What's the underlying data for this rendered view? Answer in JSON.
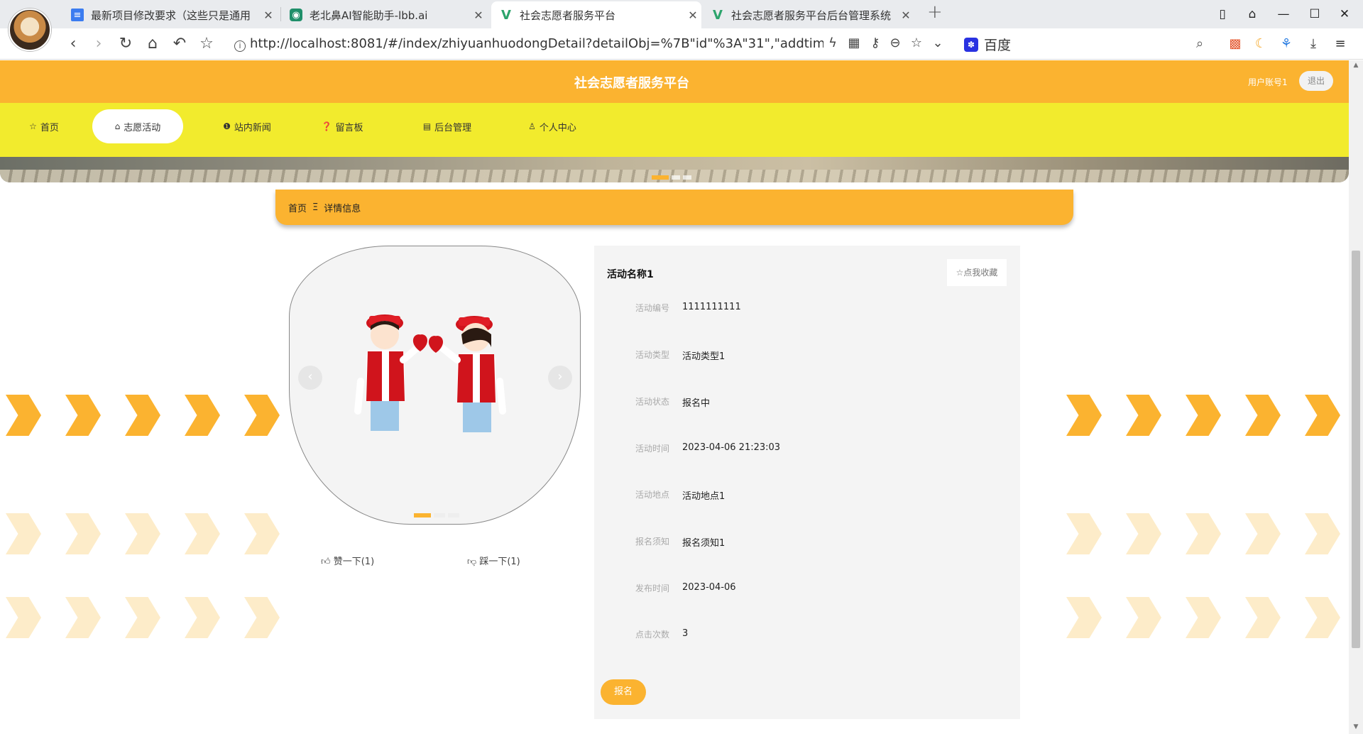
{
  "browser": {
    "tabs": [
      {
        "title": "最新项目修改要求（这些只是通用",
        "icon": "doc-icon"
      },
      {
        "title": "老北鼻AI智能助手-lbb.ai",
        "icon": "ai-icon"
      },
      {
        "title": "社会志愿者服务平台",
        "icon": "vue-icon"
      },
      {
        "title": "社会志愿者服务平台后台管理系统",
        "icon": "vue-icon"
      }
    ],
    "url": "http://localhost:8081/#/index/zhiyuanhuodongDetail?detailObj=%7B\"id\"%3A\"31\",\"addtime\"...",
    "search_engine": "百度"
  },
  "site": {
    "title": "社会志愿者服务平台",
    "user": "用户账号1",
    "logout": "退出",
    "accent": "#fbb330",
    "nav_bg": "#f2eb2d"
  },
  "nav": [
    {
      "label": "首页",
      "icon": "star-icon"
    },
    {
      "label": "志愿活动",
      "icon": "bag-icon"
    },
    {
      "label": "站内新闻",
      "icon": "info-icon"
    },
    {
      "label": "留言板",
      "icon": "question-icon"
    },
    {
      "label": "后台管理",
      "icon": "calendar-icon"
    },
    {
      "label": "个人中心",
      "icon": "user-icon"
    }
  ],
  "breadcrumb": {
    "home": "首页",
    "separator": "Ξ",
    "current": "详情信息"
  },
  "votes": {
    "like": "赞一下(1)",
    "dislike": "踩一下(1)"
  },
  "detail": {
    "title": "活动名称1",
    "favorite": "☆点我收藏",
    "fields": [
      {
        "label": "活动编号",
        "value": "1111111111"
      },
      {
        "label": "活动类型",
        "value": "活动类型1"
      },
      {
        "label": "活动状态",
        "value": "报名中"
      },
      {
        "label": "活动时间",
        "value": "2023-04-06 21:23:03"
      },
      {
        "label": "活动地点",
        "value": "活动地点1"
      },
      {
        "label": "报名须知",
        "value": "报名须知1"
      },
      {
        "label": "发布时间",
        "value": "2023-04-06"
      },
      {
        "label": "点击次数",
        "value": "3"
      }
    ],
    "signup": "报名"
  }
}
